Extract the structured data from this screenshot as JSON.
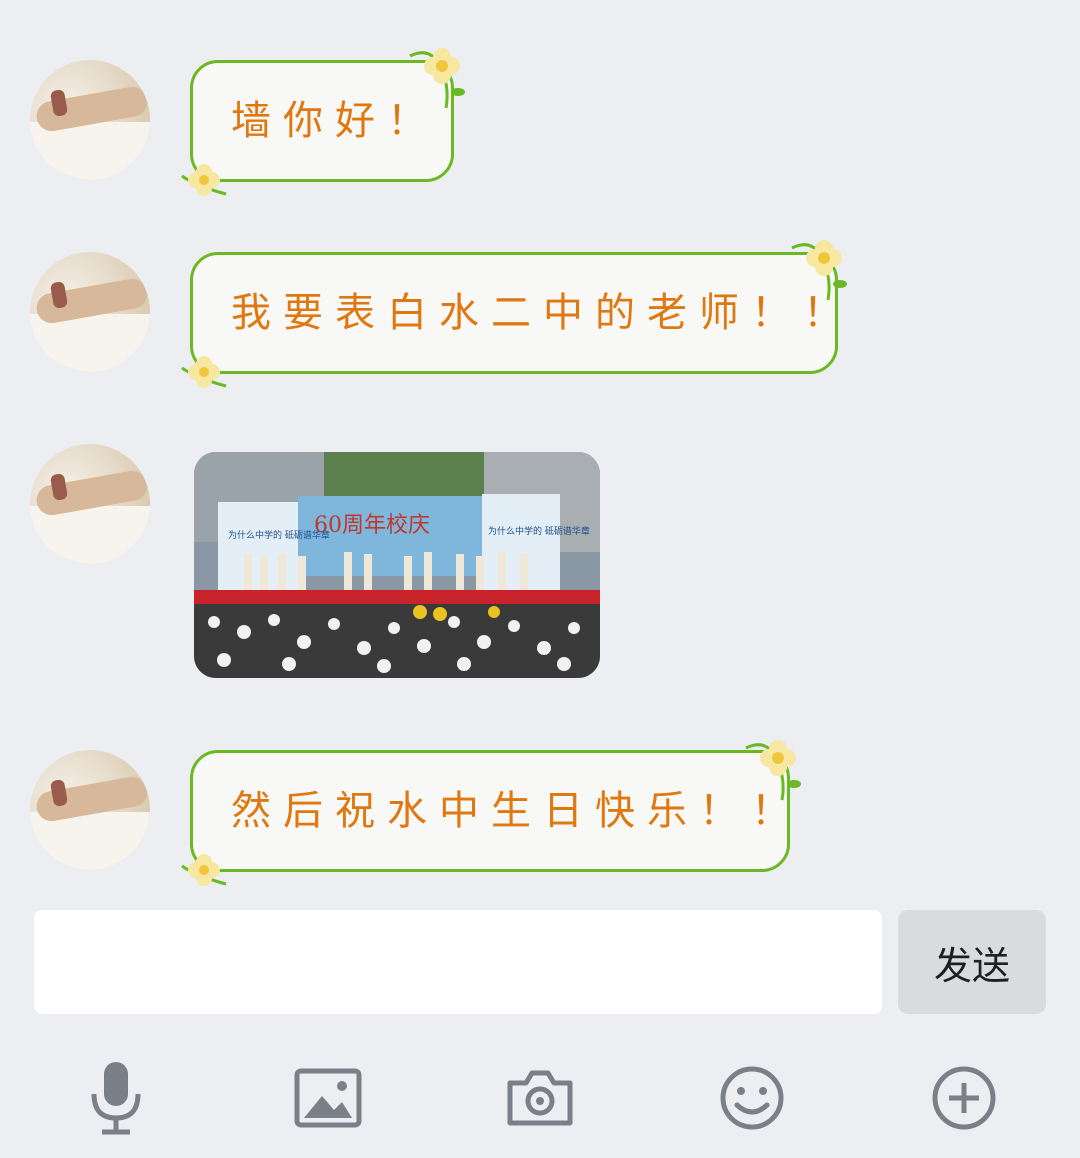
{
  "messages": [
    {
      "type": "text",
      "text": "墙你好！"
    },
    {
      "type": "text",
      "text": "我要表白水二中的老师！！"
    },
    {
      "type": "image",
      "banner_text": "60周年校庆",
      "left_sign_text": "为什么中学的 砥砺谱华章",
      "right_sign_text": "为什么中学的 砥砺谱华章"
    },
    {
      "type": "text",
      "text": "然后祝水中生日快乐！！"
    }
  ],
  "composer": {
    "input_value": "",
    "send_label": "发送"
  },
  "toolbar": {
    "icons": [
      "microphone-icon",
      "image-icon",
      "camera-icon",
      "emoji-icon",
      "plus-icon"
    ]
  },
  "colors": {
    "background": "#eceef2",
    "bubble_border": "#6ab823",
    "bubble_text": "#e07812",
    "icon": "#7b8088"
  }
}
